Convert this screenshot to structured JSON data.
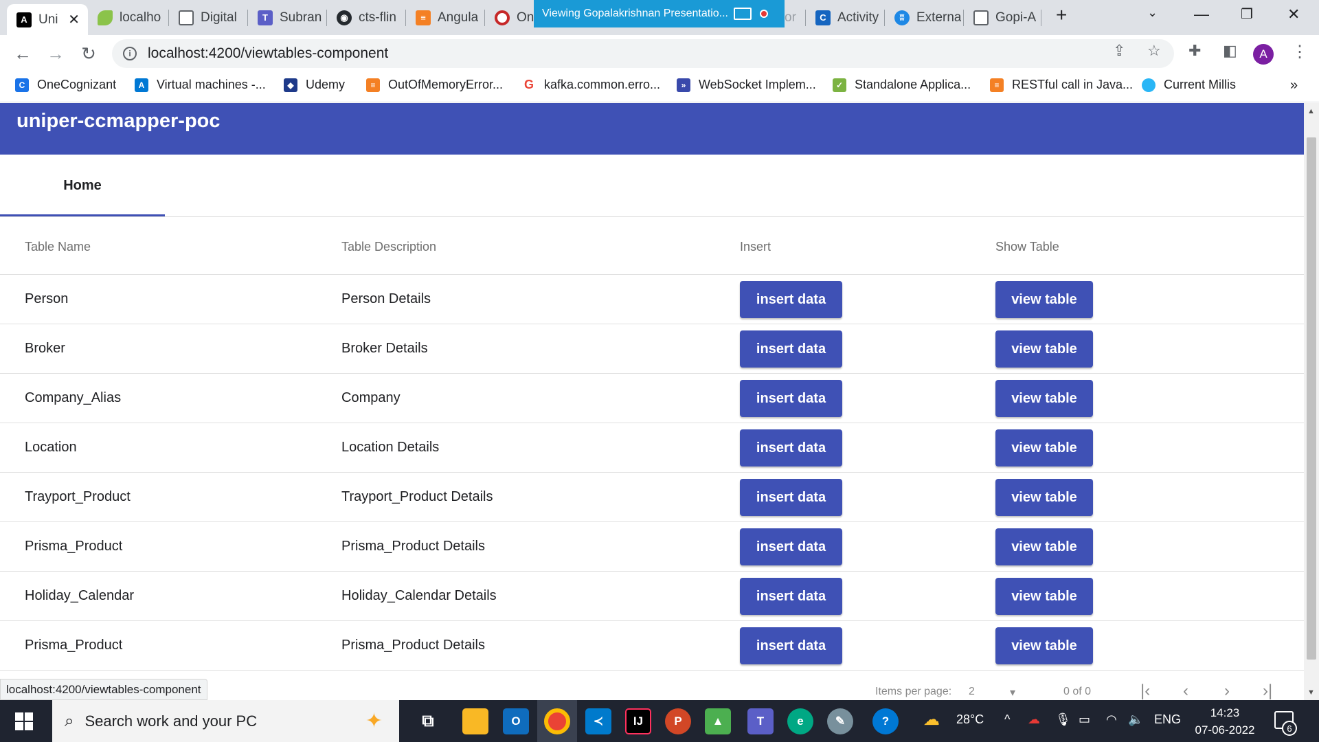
{
  "browser": {
    "tabs": [
      {
        "label": "Uni",
        "icon": "angular-icon",
        "color": "#000000"
      },
      {
        "label": "localho",
        "icon": "leaf-icon",
        "color": "#8bc34a"
      },
      {
        "label": "Digital",
        "icon": "page-icon",
        "color": "#ffffff"
      },
      {
        "label": "Subran",
        "icon": "teams-icon",
        "color": "#5b5fc7"
      },
      {
        "label": "cts-flin",
        "icon": "github-icon",
        "color": "#24292e"
      },
      {
        "label": "Angula",
        "icon": "stackoverflow-icon",
        "color": "#f48024"
      },
      {
        "label": "On",
        "icon": "opera-icon",
        "color": "#c62828"
      },
      {
        "label": "Activity",
        "icon": "c-icon",
        "color": "#1565c0"
      },
      {
        "label": "Externa",
        "icon": "butterfly-icon",
        "color": "#1e88e5"
      },
      {
        "label": "Gopi-A",
        "icon": "page-icon",
        "color": "#ffffff"
      }
    ],
    "share_banner": "Viewing Gopalakrishnan Presentatio...",
    "hidden_tab_fragment": "or",
    "url": "localhost:4200/viewtables-component",
    "avatar_letter": "A",
    "bookmarks": [
      {
        "label": "OneCognizant",
        "color": "#1a73e8"
      },
      {
        "label": "Virtual machines -...",
        "color": "#0078d4"
      },
      {
        "label": "Udemy",
        "color": "#1e3a8a"
      },
      {
        "label": "OutOfMemoryError...",
        "color": "#f48024"
      },
      {
        "label": "kafka.common.erro...",
        "color": "#ea4335"
      },
      {
        "label": "WebSocket Implem...",
        "color": "#3949ab"
      },
      {
        "label": "Standalone Applica...",
        "color": "#7cb342"
      },
      {
        "label": "RESTful call in Java...",
        "color": "#f48024"
      },
      {
        "label": "Current Millis",
        "color": "#29b6f6"
      }
    ],
    "bookmarks_more": "»",
    "status_url": "localhost:4200/viewtables-component"
  },
  "app": {
    "title": "uniper-ccmapper-poc",
    "tab_home": "Home",
    "primary_color": "#3f51b5",
    "columns": [
      "Table Name",
      "Table Description",
      "Insert",
      "Show Table"
    ],
    "insert_label": "insert data",
    "view_label": "view table",
    "rows": [
      {
        "name": "Person",
        "description": "Person Details"
      },
      {
        "name": "Broker",
        "description": "Broker Details"
      },
      {
        "name": "Company_Alias",
        "description": "Company"
      },
      {
        "name": "Location",
        "description": "Location Details"
      },
      {
        "name": "Trayport_Product",
        "description": "Trayport_Product Details"
      },
      {
        "name": "Prisma_Product",
        "description": "Prisma_Product Details"
      },
      {
        "name": "Holiday_Calendar",
        "description": "Holiday_Calendar Details"
      },
      {
        "name": "Prisma_Product",
        "description": "Prisma_Product Details"
      }
    ],
    "paginator": {
      "items_per_page_label": "Items per page:",
      "page_size": "2",
      "range": "0 of 0"
    }
  },
  "taskbar": {
    "search_placeholder": "Search work and your PC",
    "weather": "28°C",
    "language": "ENG",
    "time": "14:23",
    "date": "07-06-2022",
    "notifications": "6"
  }
}
